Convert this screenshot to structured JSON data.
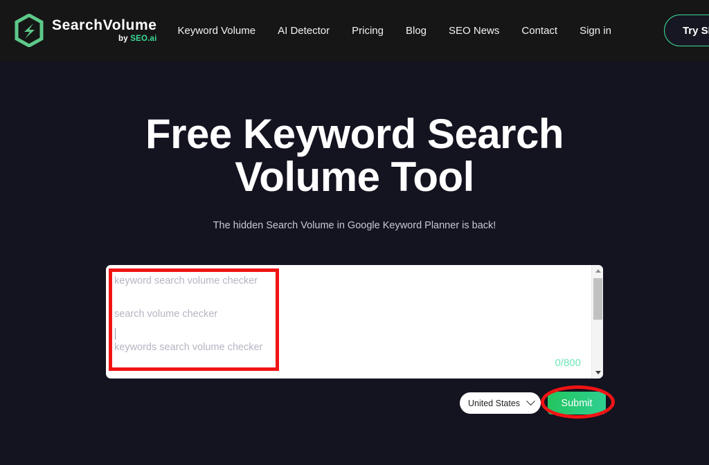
{
  "brand": {
    "name": "SearchVolume",
    "by_word": "by ",
    "by_brand": "SEO.ai",
    "logo_icon": "hexagon-bolt-icon",
    "accent_green": "#3ddc97"
  },
  "nav": {
    "items": [
      {
        "label": "Keyword Volume"
      },
      {
        "label": "AI Detector"
      },
      {
        "label": "Pricing"
      },
      {
        "label": "Blog"
      },
      {
        "label": "SEO News"
      },
      {
        "label": "Contact"
      },
      {
        "label": "Sign in"
      }
    ],
    "cta_label": "Try SEO.ai Free"
  },
  "hero": {
    "title_line1": "Free Keyword Search",
    "title_line2": "Volume Tool",
    "subtitle": "The hidden Search Volume in Google Keyword Planner is back!"
  },
  "keyword_input": {
    "placeholder_line1": "keyword search volume checker",
    "placeholder_line2": "search volume checker",
    "placeholder_line3": "keywords search volume checker",
    "value": "",
    "counter": "0/800",
    "counter_color": "#6ee7b7",
    "scrollbar_up_icon": "caret-up-icon",
    "scrollbar_down_icon": "caret-down-icon"
  },
  "controls": {
    "country_selected": "United States",
    "country_chevron_icon": "chevron-down-icon",
    "submit_label": "Submit",
    "submit_color": "#2fcf93"
  },
  "annotations": {
    "rect_color": "#f01414",
    "ellipse_color": "#f01414"
  }
}
